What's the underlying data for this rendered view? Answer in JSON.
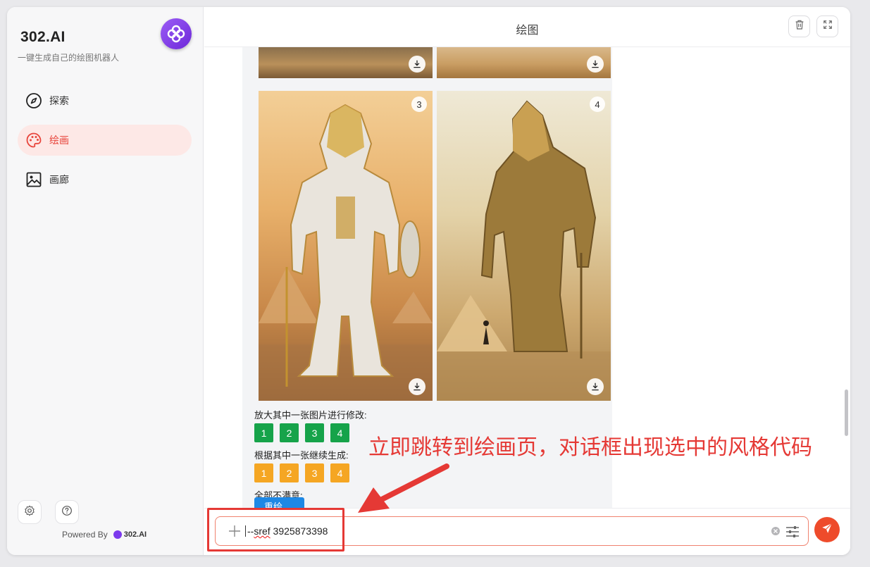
{
  "sidebar": {
    "brand": "302.AI",
    "tagline": "一键生成自己的绘图机器人",
    "items": [
      {
        "label": "探索",
        "icon": "compass-icon",
        "active": false
      },
      {
        "label": "绘画",
        "icon": "palette-icon",
        "active": true
      },
      {
        "label": "画廊",
        "icon": "image-icon",
        "active": false
      }
    ],
    "footer": {
      "settings_icon": "gear-icon",
      "help_icon": "help-icon",
      "powered_by": "Powered By",
      "powered_brand": "302.AI"
    }
  },
  "header": {
    "title": "绘图",
    "delete_icon": "trash-icon",
    "fullscreen_icon": "fullscreen-icon"
  },
  "gallery": {
    "images": [
      {
        "index": "",
        "subject": "top-left desert image (cropped)"
      },
      {
        "index": "",
        "subject": "top-right desert image (cropped)"
      },
      {
        "index": "3",
        "subject": "white and gold armored pharaoh robot"
      },
      {
        "index": "4",
        "subject": "golden pharaoh giant statue"
      }
    ],
    "upscale_label": "放大其中一张图片进行修改:",
    "upscale_buttons": [
      "1",
      "2",
      "3",
      "4"
    ],
    "variation_label": "根据其中一张继续生成:",
    "variation_buttons": [
      "1",
      "2",
      "3",
      "4"
    ],
    "reject_label": "全部不满意:",
    "redraw_label": "重绘"
  },
  "input": {
    "value_prefix": "--",
    "value_spell": "sref",
    "value_rest": " 3925873398"
  },
  "annotation": {
    "text": "立即跳转到绘画页，对话框出现选中的风格代码"
  },
  "colors": {
    "accent": "#ee4b2b",
    "upscale": "#16a34a",
    "variation": "#f5a623",
    "annotation": "#e53935"
  }
}
